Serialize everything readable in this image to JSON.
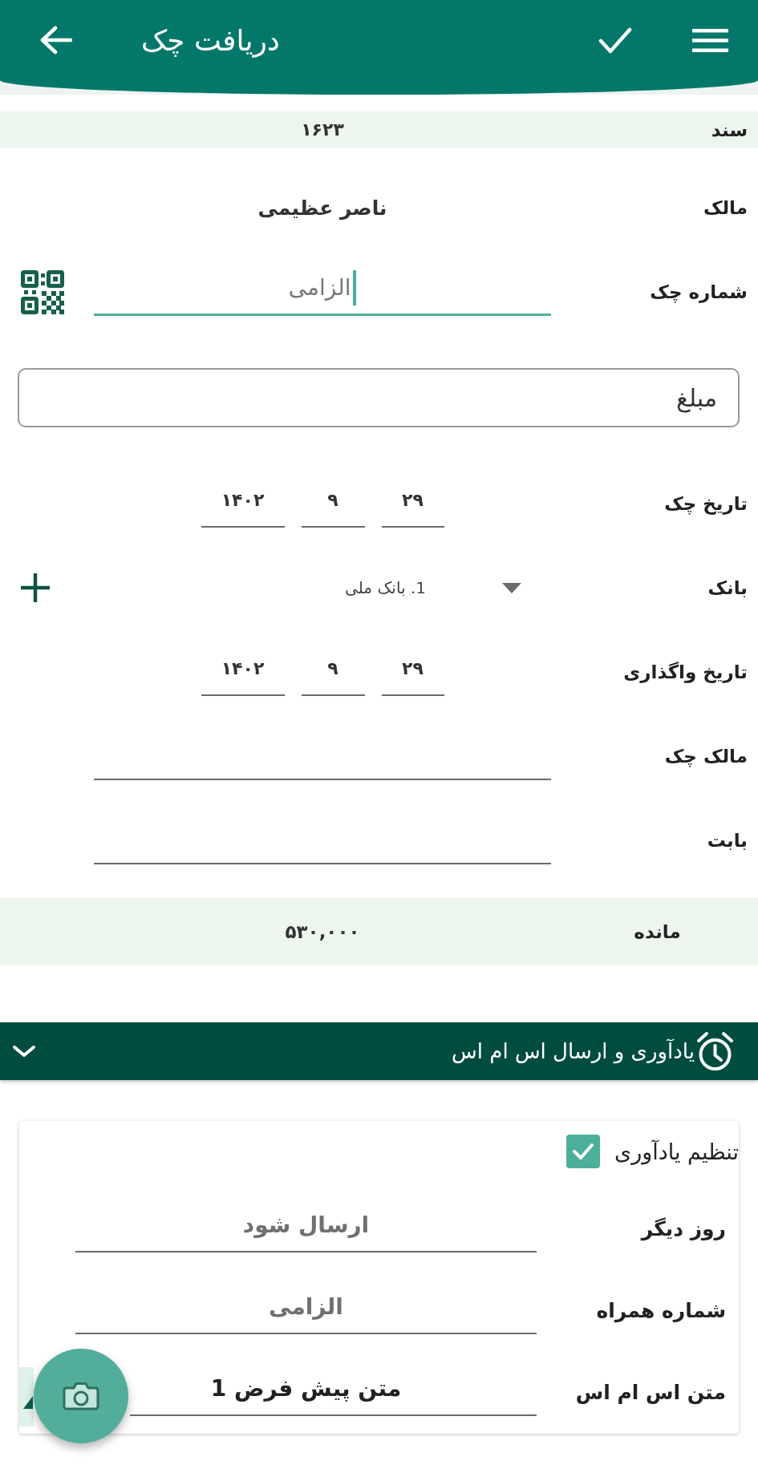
{
  "app_bar": {
    "title": "دریافت چک"
  },
  "document": {
    "label": "سند",
    "value": "۱۶۲۳"
  },
  "form": {
    "rows": [
      {
        "kind": "text",
        "label": "مالک",
        "value": "ناصر عظیمی"
      },
      {
        "kind": "input",
        "label": "شماره چک",
        "placeholder": "الزامی",
        "focused": true,
        "scan_button": true
      },
      {
        "kind": "outlined",
        "placeholder": "مبلغ"
      },
      {
        "kind": "date",
        "label": "تاریخ چک",
        "day": "۲۹",
        "month": "۹",
        "year": "۱۴۰۲"
      },
      {
        "kind": "dropdown",
        "label": "بانک",
        "value": "1. بانک ملی",
        "add_button": true
      },
      {
        "kind": "date",
        "label": "تاریخ واگذاری",
        "day": "۲۹",
        "month": "۹",
        "year": "۱۴۰۲"
      },
      {
        "kind": "input",
        "label": "مالک چک",
        "focused": false
      },
      {
        "kind": "input",
        "label": "بابت",
        "focused": false
      }
    ]
  },
  "balance": {
    "label": "مانده",
    "value": "۵۳۰,۰۰۰"
  },
  "reminder": {
    "title": "یادآوری و ارسال اس ام اس",
    "expanded": true,
    "set_reminder": {
      "label": "تنظیم یادآوری",
      "checked": true
    },
    "rows": [
      {
        "kind": "input",
        "label": "روز دیگر",
        "placeholder": "ارسال شود"
      },
      {
        "kind": "input",
        "label": "شماره همراه",
        "placeholder": "الزامی"
      },
      {
        "kind": "input",
        "label": "متن اس ام اس",
        "value": "متن پیش فرض 1"
      }
    ]
  }
}
